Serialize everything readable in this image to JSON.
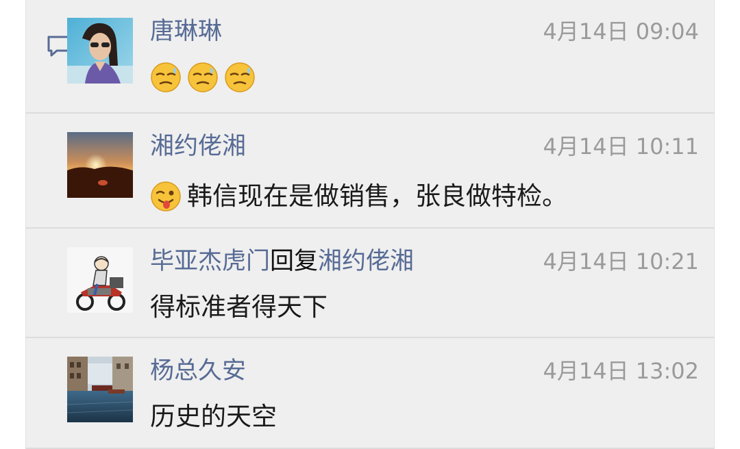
{
  "comments": [
    {
      "name": "唐琳琳",
      "time": "4月14日 09:04",
      "text": "",
      "emojis": [
        "sweat-emoji",
        "sweat-emoji",
        "sweat-emoji"
      ]
    },
    {
      "name": "湘约佬湘",
      "time": "4月14日 10:11",
      "text": "韩信现在是做销售，张良做特检。",
      "emojis": [
        "wink-tongue-emoji"
      ]
    },
    {
      "name": "毕亚杰虎门",
      "reply_word": "回复",
      "reply_to": "湘约佬湘",
      "time": "4月14日 10:21",
      "text": "得标准者得天下"
    },
    {
      "name": "杨总久安",
      "time": "4月14日 13:02",
      "text": "历史的天空"
    }
  ],
  "icons": {
    "comment": "comment-bubble-icon"
  },
  "colors": {
    "name": "#576b95",
    "time": "#9a9a9a",
    "background": "#efefef",
    "divider": "#dcdcdc"
  }
}
